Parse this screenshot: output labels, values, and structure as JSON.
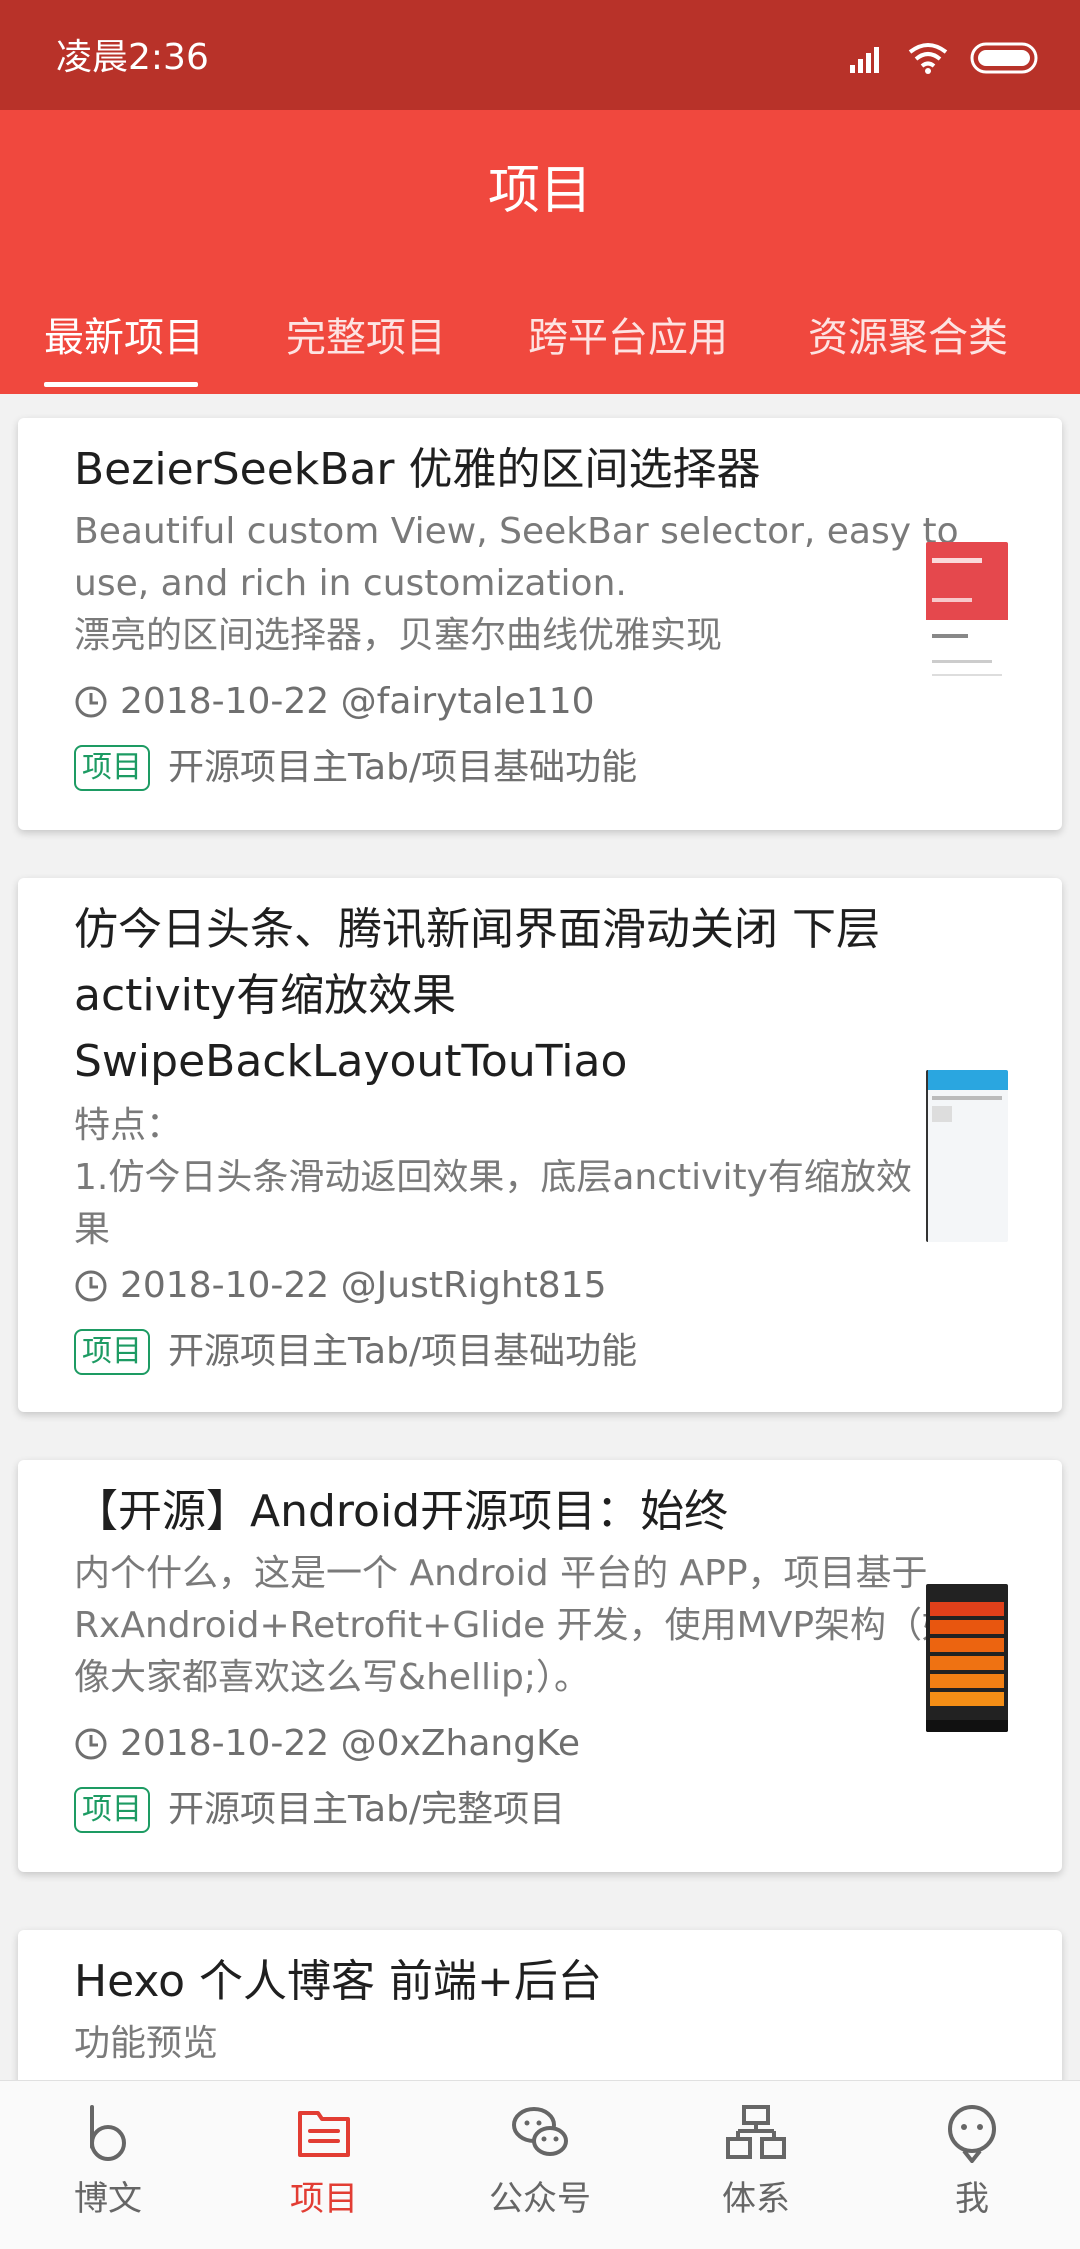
{
  "status_bar": {
    "time": "凌晨2:36"
  },
  "app_bar": {
    "title": "项目"
  },
  "tabs": [
    {
      "label": "最新项目",
      "active": true
    },
    {
      "label": "完整项目",
      "active": false
    },
    {
      "label": "跨平台应用",
      "active": false
    },
    {
      "label": "资源聚合类",
      "active": false
    }
  ],
  "cards": [
    {
      "title_lines": [
        "BezierSeekBar 优雅的区间选择器"
      ],
      "desc_lines": [
        "Beautiful custom View, SeekBar selector, easy to",
        "use, and rich in customization.",
        "漂亮的区间选择器，贝塞尔曲线优雅实现"
      ],
      "date_author": "2018-10-22 @fairytale110",
      "tag": "项目",
      "category": "开源项目主Tab/项目基础功能",
      "thumb": {
        "top_color": "#e5484d",
        "body_color": "#ffffff"
      }
    },
    {
      "title_lines": [
        "仿今日头条、腾讯新闻界面滑动关闭 下层",
        "activity有缩放效果",
        "SwipeBackLayoutTouTiao"
      ],
      "desc_lines": [
        "特点：",
        "1.仿今日头条滑动返回效果，底层anctivity有缩放效",
        "果"
      ],
      "date_author": "2018-10-22 @JustRight815",
      "tag": "项目",
      "category": "开源项目主Tab/项目基础功能",
      "thumb": {
        "top_color": "#2aa6e0",
        "body_color": "#f4f6f8"
      }
    },
    {
      "title_lines": [
        "【开源】Android开源项目：始终"
      ],
      "desc_lines": [
        "内个什么，这是一个 Android 平台的 APP，项目基于",
        "RxAndroid+Retrofit+Glide 开发，使用MVP架构（好",
        "像大家都喜欢这么写&hellip;）。"
      ],
      "date_author": "2018-10-22 @0xZhangKe",
      "tag": "项目",
      "category": "开源项目主Tab/完整项目",
      "thumb": {
        "top_color": "#222222",
        "body_color": "#e8630f"
      }
    },
    {
      "title_lines": [
        "Hexo 个人博客 前端+后台"
      ],
      "desc_lines": [
        "功能预览"
      ]
    }
  ],
  "bottom_nav": [
    {
      "label": "博文",
      "icon": "blog-icon",
      "active": false
    },
    {
      "label": "项目",
      "icon": "project-icon",
      "active": true
    },
    {
      "label": "公众号",
      "icon": "wechat-icon",
      "active": false
    },
    {
      "label": "体系",
      "icon": "system-icon",
      "active": false
    },
    {
      "label": "我",
      "icon": "profile-icon",
      "active": false
    }
  ],
  "colors": {
    "status_bar": "#b83229",
    "app_bar": "#f0483e",
    "tag_green": "#1d9b63",
    "nav_active": "#e23d33"
  }
}
